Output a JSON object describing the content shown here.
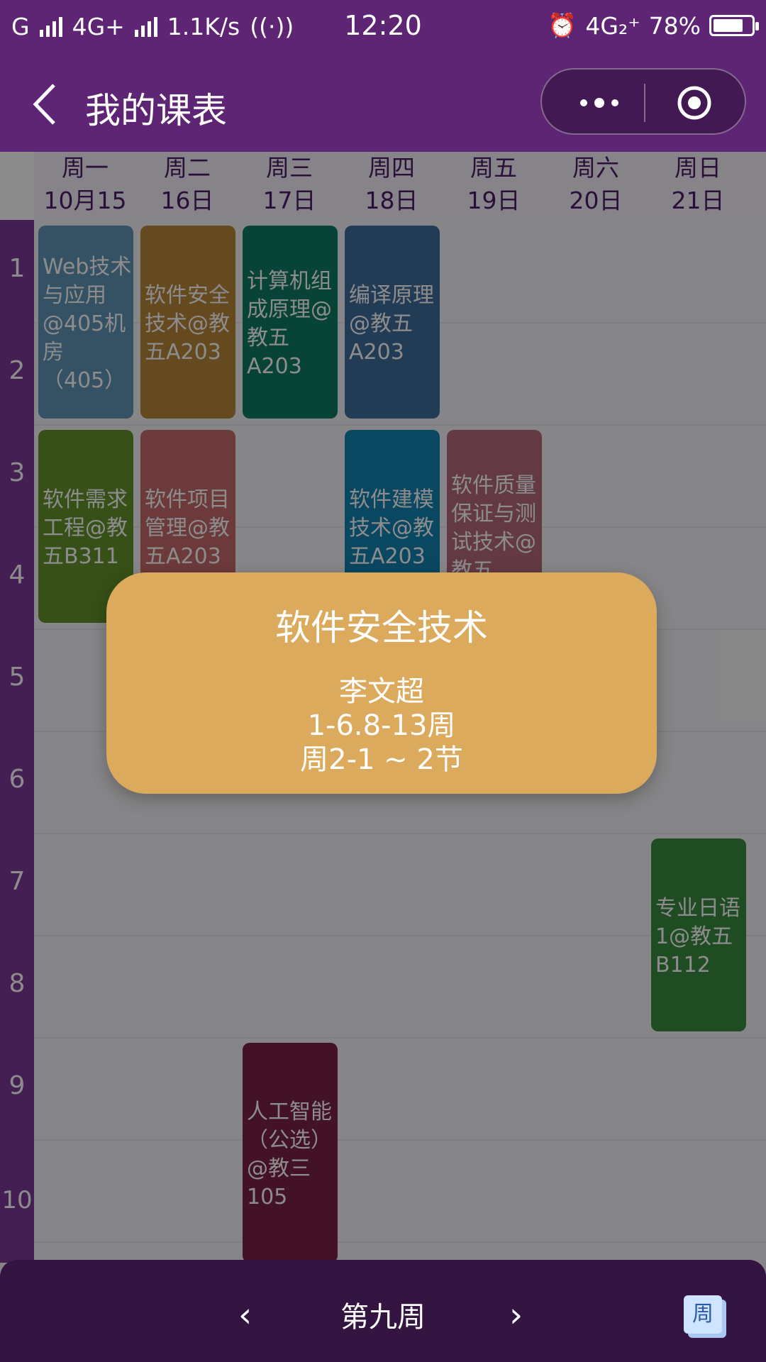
{
  "status_bar": {
    "carrier": "G",
    "network": "4G+",
    "speed": "1.1K/s",
    "time": "12:20",
    "network2": "4G₂⁺",
    "battery_text": "78%",
    "battery_level": 0.78
  },
  "header": {
    "title": "我的课表"
  },
  "days": [
    {
      "weekday": "周一",
      "date": "10月15"
    },
    {
      "weekday": "周二",
      "date": "16日"
    },
    {
      "weekday": "周三",
      "date": "17日"
    },
    {
      "weekday": "周四",
      "date": "18日"
    },
    {
      "weekday": "周五",
      "date": "19日"
    },
    {
      "weekday": "周六",
      "date": "20日"
    },
    {
      "weekday": "周日",
      "date": "21日"
    }
  ],
  "periods": [
    "1",
    "2",
    "3",
    "4",
    "5",
    "6",
    "7",
    "8",
    "9",
    "10"
  ],
  "courses": [
    {
      "text": "Web技术与应用@405机房（405）",
      "color": "#5f95b4"
    },
    {
      "text": "软件安全技术@教五A203",
      "color": "#b8863a"
    },
    {
      "text": "计算机组成原理@教五A203",
      "color": "#0f7a64"
    },
    {
      "text": "编译原理@教五A203",
      "color": "#3e6d9b"
    },
    {
      "text": "软件需求工程@教五B311",
      "color": "#63932d"
    },
    {
      "text": "软件项目管理@教五A203",
      "color": "#c56a6a"
    },
    {
      "text": "软件建模技术@教五A203",
      "color": "#1382b0"
    },
    {
      "text": "软件质量保证与测试技术@教五",
      "color": "#b56a7a"
    },
    {
      "text": "专业日语1@教五B112",
      "color": "#3a8a3e"
    },
    {
      "text": "人工智能（公选）@教三105",
      "color": "#7a2148"
    }
  ],
  "bottom": {
    "prev": "‹",
    "week": "第九周",
    "next": "›",
    "week_button": "周"
  },
  "popup": {
    "title": "软件安全技术",
    "teacher": "李文超",
    "weeks": "1-6.8-13周",
    "time": "周2-1 ~ 2节"
  }
}
